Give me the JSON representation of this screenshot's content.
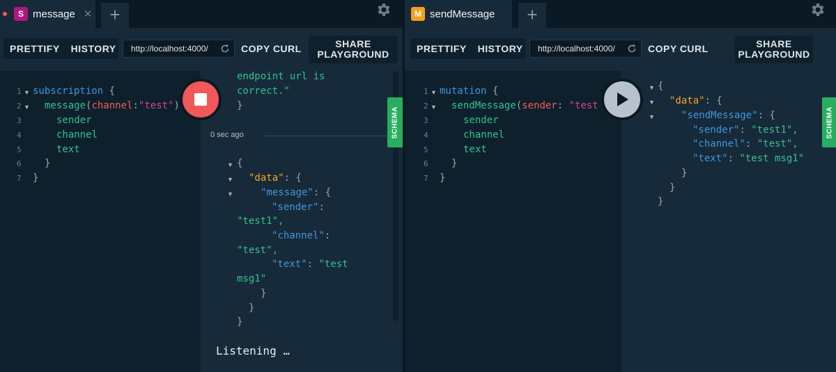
{
  "left": {
    "tab": {
      "badge": "S",
      "badge_color": "#b0177e",
      "title": "message",
      "close": "✕",
      "unsaved": true
    },
    "add_tab": "+",
    "toolbar": {
      "prettify": "PRETTIFY",
      "history": "HISTORY",
      "url": "http://localhost:4000/",
      "copy_curl": "COPY CURL",
      "share_line1": "SHARE",
      "share_line2": "PLAYGROUND"
    },
    "editor_lines": [
      "1",
      "2",
      "3",
      "4",
      "5",
      "6",
      "7"
    ],
    "query": {
      "op": "subscription",
      "field": "message",
      "arg_name": "channel",
      "arg_value": "\"test\"",
      "fields": [
        "sender",
        "channel",
        "text"
      ]
    },
    "exec_state": "stop",
    "schema_label": "SCHEMA",
    "result_top": {
      "line1": "endpoint url is",
      "line2": "correct.\"",
      "line3": "}"
    },
    "timestamp": "0 sec ago",
    "result": {
      "data_key": "\"data\"",
      "message_key": "\"message\"",
      "sender_key": "\"sender\"",
      "sender_val": "\"test1\",",
      "channel_key": "\"channel\"",
      "channel_val": "\"test\",",
      "text_key": "\"text\"",
      "text_val1": "\"test",
      "text_val2": "msg1\""
    },
    "listening": "Listening …"
  },
  "right": {
    "tab": {
      "badge": "M",
      "badge_color": "#f5a01a",
      "title": "sendMessage"
    },
    "add_tab": "+",
    "toolbar": {
      "prettify": "PRETTIFY",
      "history": "HISTORY",
      "url": "http://localhost:4000/",
      "copy_curl": "COPY CURL",
      "share_line1": "SHARE",
      "share_line2": "PLAYGROUND"
    },
    "editor_lines": [
      "1",
      "2",
      "3",
      "4",
      "5",
      "6",
      "7"
    ],
    "query": {
      "op": "mutation",
      "field": "sendMessage",
      "arg_name": "sender",
      "arg_value": "\"test",
      "fields": [
        "sender",
        "channel",
        "text"
      ]
    },
    "exec_state": "play",
    "schema_label": "SCHEMA",
    "result": {
      "data_key": "\"data\"",
      "send_key": "\"sendMessage\"",
      "sender_key": "\"sender\"",
      "sender_val": "\"test1\",",
      "channel_key": "\"channel\"",
      "channel_val": "\"test\",",
      "text_key": "\"text\"",
      "text_val": "\"test msg1\""
    }
  }
}
